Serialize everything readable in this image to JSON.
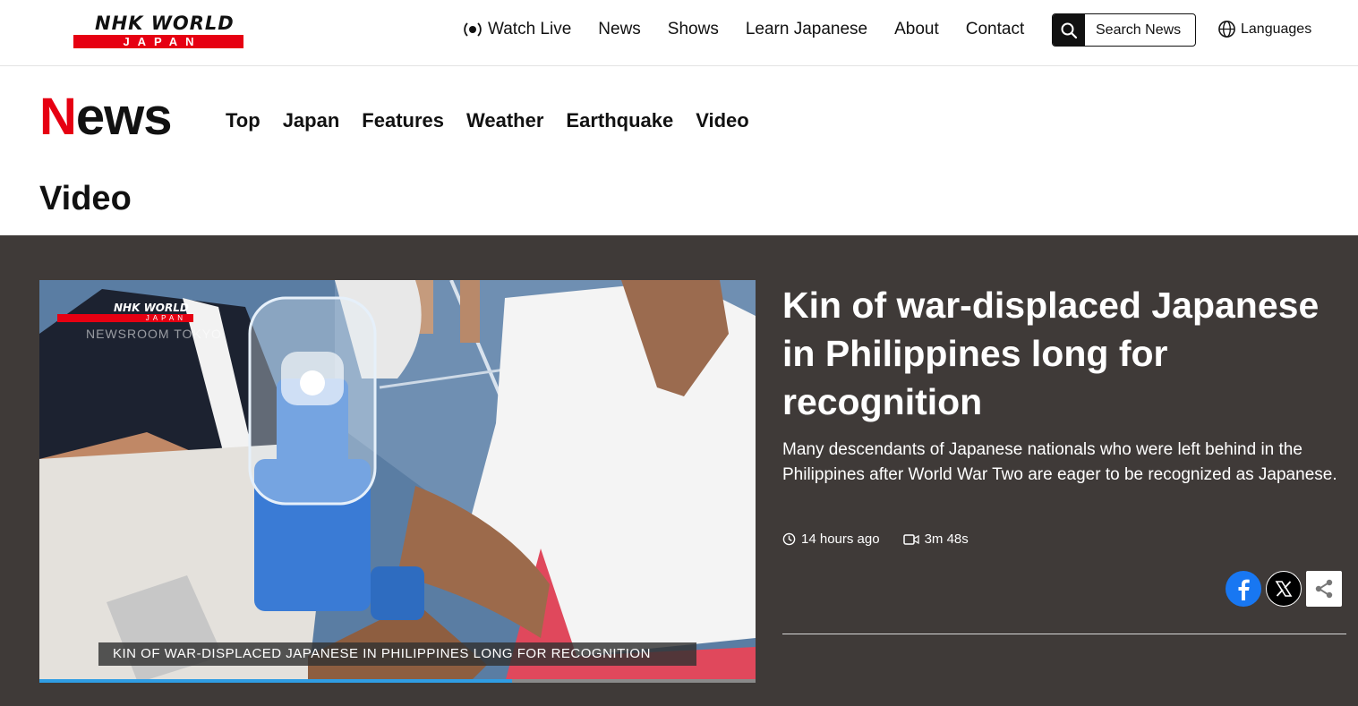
{
  "brand": {
    "logo_line1": "NHK WORLD",
    "logo_line2": "JAPAN",
    "accent": "#e60012"
  },
  "global_nav": {
    "watch_live": "Watch Live",
    "items": [
      "News",
      "Shows",
      "Learn Japanese",
      "About",
      "Contact"
    ],
    "search_label": "Search News",
    "languages": "Languages"
  },
  "section": {
    "mark_first": "N",
    "mark_rest": "ews",
    "subnav": [
      "Top",
      "Japan",
      "Features",
      "Weather",
      "Earthquake",
      "Video"
    ],
    "page_title": "Video"
  },
  "feature": {
    "player_logo": "NHK WORLD",
    "player_logo_sub": "JAPAN",
    "player_tag": "NEWSROOM TOKYO",
    "caption": "KIN OF WAR-DISPLACED JAPANESE IN PHILIPPINES LONG FOR RECOGNITION",
    "progress_fraction": 0.66,
    "headline": "Kin of war-displaced Japanese in Philippines long for recognition",
    "summary": "Many descendants of Japanese nationals who were left behind in the Philippines after World War Two are eager to be recognized as Japanese.",
    "time_ago": "14 hours ago",
    "duration": "3m 48s",
    "band_color": "#3f3a38",
    "progress_color": "#2f9de4"
  },
  "share": {
    "facebook_color": "#1877f2",
    "x_color": "#000000"
  },
  "icons": [
    "broadcast-icon",
    "search-icon",
    "globe-icon",
    "clock-icon",
    "video-camera-icon",
    "facebook-icon",
    "x-icon",
    "share-icon"
  ]
}
